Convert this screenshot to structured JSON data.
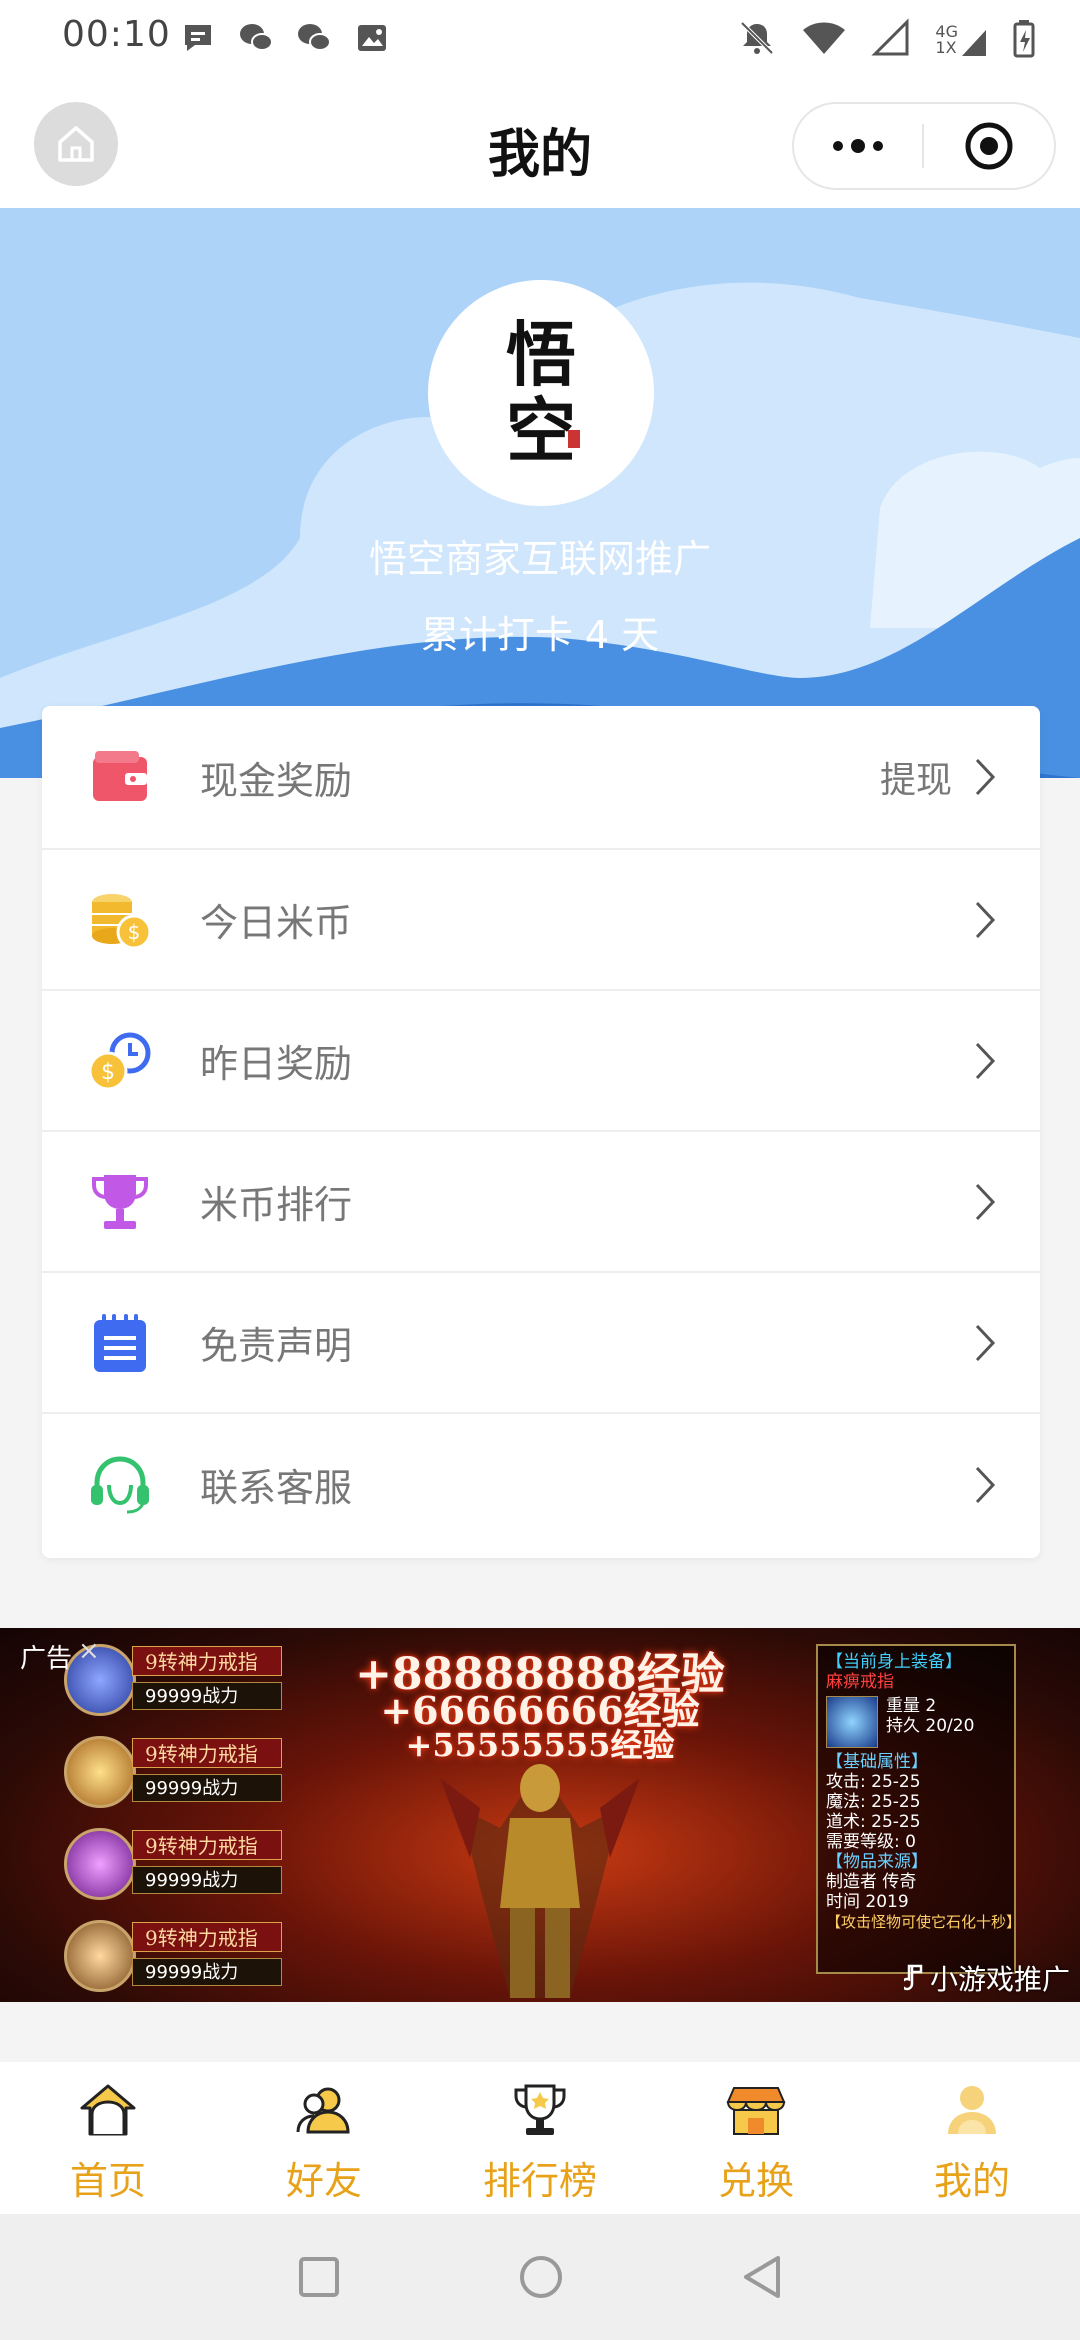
{
  "status_bar": {
    "time": "00:10",
    "network": "4G",
    "network_sub": "1X"
  },
  "header": {
    "title": "我的"
  },
  "profile": {
    "logo_text": "悟空",
    "name": "悟空商家互联网推广",
    "checkin": "累计打卡 4 天"
  },
  "menu": [
    {
      "label": "现金奖励",
      "extra": "提现",
      "icon": "wallet-icon",
      "color": "#f0566a"
    },
    {
      "label": "今日米币",
      "extra": "",
      "icon": "coins-icon",
      "color": "#f2b92e"
    },
    {
      "label": "昨日奖励",
      "extra": "",
      "icon": "coin-clock-icon",
      "color": "#f2b92e"
    },
    {
      "label": "米币排行",
      "extra": "",
      "icon": "trophy-icon",
      "color": "#c159e6"
    },
    {
      "label": "免责声明",
      "extra": "",
      "icon": "notepad-icon",
      "color": "#3f6bf0"
    },
    {
      "label": "联系客服",
      "extra": "",
      "icon": "headset-icon",
      "color": "#34c26e"
    }
  ],
  "ad": {
    "tag": "广告",
    "close": "×",
    "items": [
      {
        "title": "9转神力戒指",
        "power": "99999战力"
      },
      {
        "title": "9转神力戒指",
        "power": "99999战力"
      },
      {
        "title": "9转神力戒指",
        "power": "99999战力"
      },
      {
        "title": "9转神力戒指",
        "power": "99999战力"
      }
    ],
    "exp_lines": [
      "+88888888经验",
      "+66666666经验",
      "+55555555经验"
    ],
    "equip": {
      "header": "【当前身上装备】",
      "item_name": "麻痹戒指",
      "weight": "重量 2",
      "durability": "持久 20/20",
      "attr_header": "【基础属性】",
      "attack": "攻击:  25-25",
      "magic": "魔法:  25-25",
      "tao": "道术:  25-25",
      "level": "需要等级:  0",
      "source_header": "【物品来源】",
      "maker": "制造者 传奇",
      "time": "时间  2019",
      "footer": "【攻击怪物可使它石化十秒】"
    },
    "source": "小游戏推广"
  },
  "tabs": [
    {
      "label": "首页",
      "icon": "home-icon"
    },
    {
      "label": "好友",
      "icon": "friends-icon"
    },
    {
      "label": "排行榜",
      "icon": "trophy-icon"
    },
    {
      "label": "兑换",
      "icon": "shop-icon"
    },
    {
      "label": "我的",
      "icon": "user-icon"
    }
  ],
  "colors": {
    "accent": "#e8a21a",
    "sky": "#aed3f8",
    "cloud": "#cfe6fc",
    "wave": "#4a90e2"
  }
}
